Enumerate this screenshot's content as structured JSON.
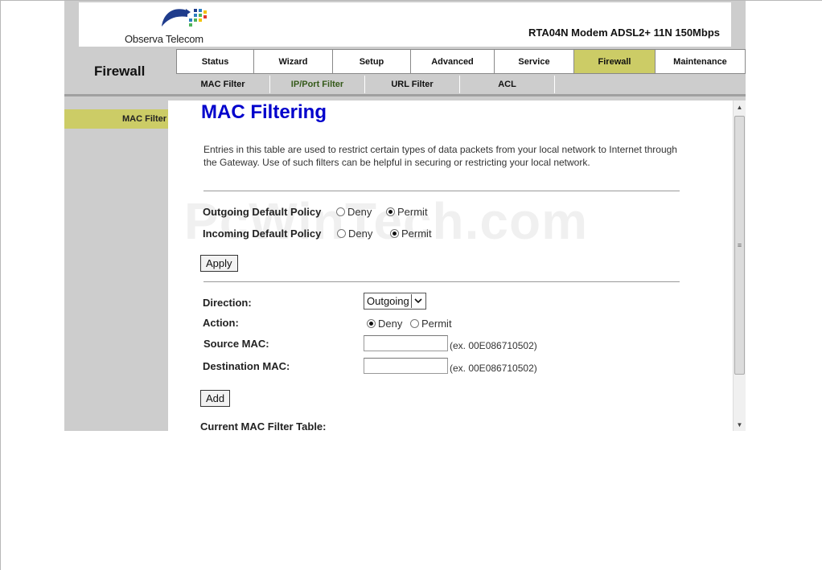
{
  "header": {
    "brand": "Observa Telecom",
    "model": "RTA04N Modem ADSL2+ 11N 150Mbps",
    "section": "Firewall"
  },
  "nav": {
    "tabs": [
      {
        "label": "Status",
        "active": false
      },
      {
        "label": "Wizard",
        "active": false
      },
      {
        "label": "Setup",
        "active": false
      },
      {
        "label": "Advanced",
        "active": false
      },
      {
        "label": "Service",
        "active": false
      },
      {
        "label": "Firewall",
        "active": true
      },
      {
        "label": "Maintenance",
        "active": false
      }
    ],
    "subtabs": [
      {
        "label": "MAC Filter",
        "active": false
      },
      {
        "label": "IP/Port Filter",
        "active": true
      },
      {
        "label": "URL Filter",
        "active": false
      },
      {
        "label": "ACL",
        "active": false
      }
    ]
  },
  "sidebar": {
    "items": [
      {
        "label": "MAC Filter",
        "active": true
      }
    ]
  },
  "page": {
    "title": "MAC Filtering",
    "description": "Entries in this table are used to restrict certain types of data packets from your local network to Internet through the Gateway. Use of such filters can be helpful in securing or restricting your local network.",
    "watermark": "PcWinTech.com"
  },
  "policy": {
    "outgoing_label": "Outgoing Default Policy",
    "incoming_label": "Incoming Default Policy",
    "deny_label": "Deny",
    "permit_label": "Permit",
    "outgoing_value": "Permit",
    "incoming_value": "Permit",
    "apply_label": "Apply"
  },
  "rule": {
    "direction_label": "Direction:",
    "direction_value": "Outgoing",
    "action_label": "Action:",
    "action_deny": "Deny",
    "action_permit": "Permit",
    "action_value": "Deny",
    "source_label": "Source MAC:",
    "source_value": "",
    "dest_label": "Destination MAC:",
    "dest_value": "",
    "example": "(ex. 00E086710502)",
    "add_label": "Add"
  },
  "table": {
    "heading": "Current MAC Filter Table:"
  },
  "colors": {
    "accent": "#cccc66",
    "title_blue": "#0000cc",
    "panel_gray": "#cdcdcd"
  }
}
